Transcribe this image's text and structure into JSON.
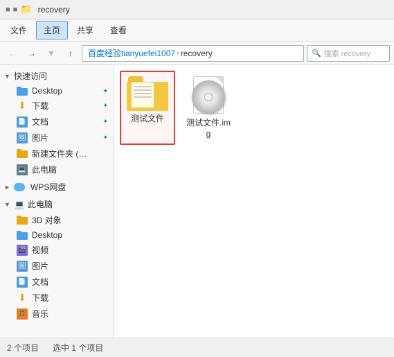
{
  "titleBar": {
    "title": "recovery",
    "windowControls": [
      "minimize",
      "maximize",
      "close"
    ]
  },
  "ribbon": {
    "tabs": [
      "文件",
      "主页",
      "共享",
      "查看"
    ],
    "activeTab": "主页"
  },
  "navBar": {
    "backBtn": "←",
    "forwardBtn": "→",
    "upBtn": "↑",
    "recentBtn": "▾",
    "addressParts": [
      "百度经验tianyuefei1007",
      "recovery"
    ],
    "searchPlaceholder": "搜索 recovery"
  },
  "sidebar": {
    "quickAccess": {
      "header": "快速访问",
      "items": [
        {
          "label": "Desktop",
          "type": "folder-blue",
          "pinned": true
        },
        {
          "label": "下载",
          "type": "download",
          "pinned": true
        },
        {
          "label": "文档",
          "type": "folder-img",
          "pinned": true
        },
        {
          "label": "图片",
          "type": "folder-img",
          "pinned": true
        },
        {
          "label": "新建文件夹 (…",
          "type": "folder-yellow",
          "pinned": false
        },
        {
          "label": "此电脑",
          "type": "pc",
          "pinned": false
        }
      ]
    },
    "wps": {
      "header": "WPS网盘",
      "type": "cloud"
    },
    "thisPC": {
      "header": "此电脑",
      "items": [
        {
          "label": "3D 对象",
          "type": "folder-3d"
        },
        {
          "label": "Desktop",
          "type": "folder-blue"
        },
        {
          "label": "视频",
          "type": "folder-video"
        },
        {
          "label": "图片",
          "type": "folder-img"
        },
        {
          "label": "文档",
          "type": "folder-img"
        },
        {
          "label": "下载",
          "type": "download"
        },
        {
          "label": "音乐",
          "type": "folder-music"
        }
      ]
    }
  },
  "fileView": {
    "items": [
      {
        "id": "folder-ceshi",
        "name": "测试文件",
        "type": "folder",
        "selected": true,
        "selectedStyle": "red"
      },
      {
        "id": "file-img",
        "name": "测试文件.img",
        "type": "img-file",
        "selected": false
      }
    ]
  },
  "statusBar": {
    "itemCount": "2 个项目",
    "selectedCount": "选中 1 个项目"
  }
}
